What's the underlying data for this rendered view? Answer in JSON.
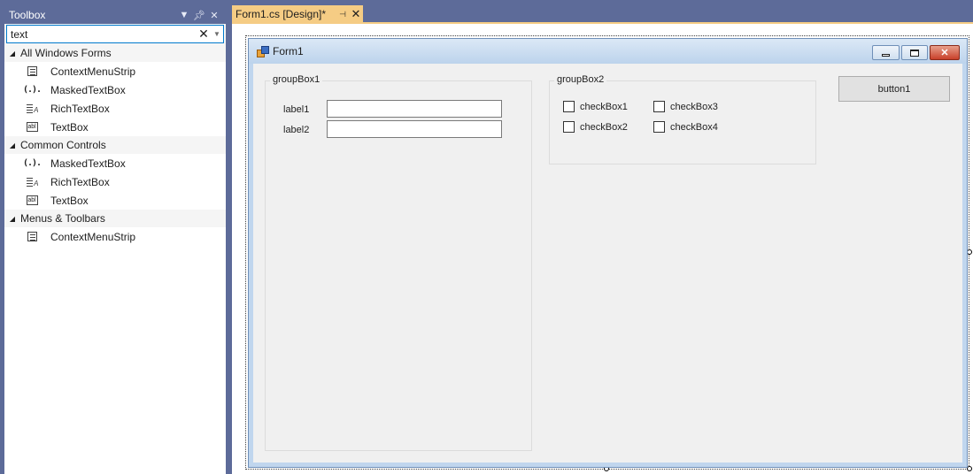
{
  "toolbox": {
    "title": "Toolbox",
    "search": {
      "value": "text"
    },
    "categories": [
      {
        "name": "All Windows Forms",
        "items": [
          {
            "label": "ContextMenuStrip",
            "icon": "context-menu-strip-icon"
          },
          {
            "label": "MaskedTextBox",
            "icon": "masked-textbox-icon",
            "glyph": "(.)."
          },
          {
            "label": "RichTextBox",
            "icon": "rich-textbox-icon"
          },
          {
            "label": "TextBox",
            "icon": "textbox-icon",
            "glyph": "abl"
          }
        ]
      },
      {
        "name": "Common Controls",
        "items": [
          {
            "label": "MaskedTextBox",
            "icon": "masked-textbox-icon",
            "glyph": "(.)."
          },
          {
            "label": "RichTextBox",
            "icon": "rich-textbox-icon"
          },
          {
            "label": "TextBox",
            "icon": "textbox-icon",
            "glyph": "abl"
          }
        ]
      },
      {
        "name": "Menus & Toolbars",
        "items": [
          {
            "label": "ContextMenuStrip",
            "icon": "context-menu-strip-icon"
          }
        ]
      }
    ]
  },
  "tab": {
    "label": "Form1.cs [Design]*"
  },
  "form": {
    "title": "Form1",
    "groupBox1": {
      "title": "groupBox1",
      "label1": "label1",
      "label2": "label2"
    },
    "groupBox2": {
      "title": "groupBox2",
      "checkBox1": "checkBox1",
      "checkBox2": "checkBox2",
      "checkBox3": "checkBox3",
      "checkBox4": "checkBox4"
    },
    "button1": "button1"
  },
  "colors": {
    "chrome": "#5d6b99",
    "active_tab": "#f5cc84",
    "form_border": "#c0d6ee",
    "client_bg": "#f0f0f0",
    "accent": "#007acc"
  }
}
